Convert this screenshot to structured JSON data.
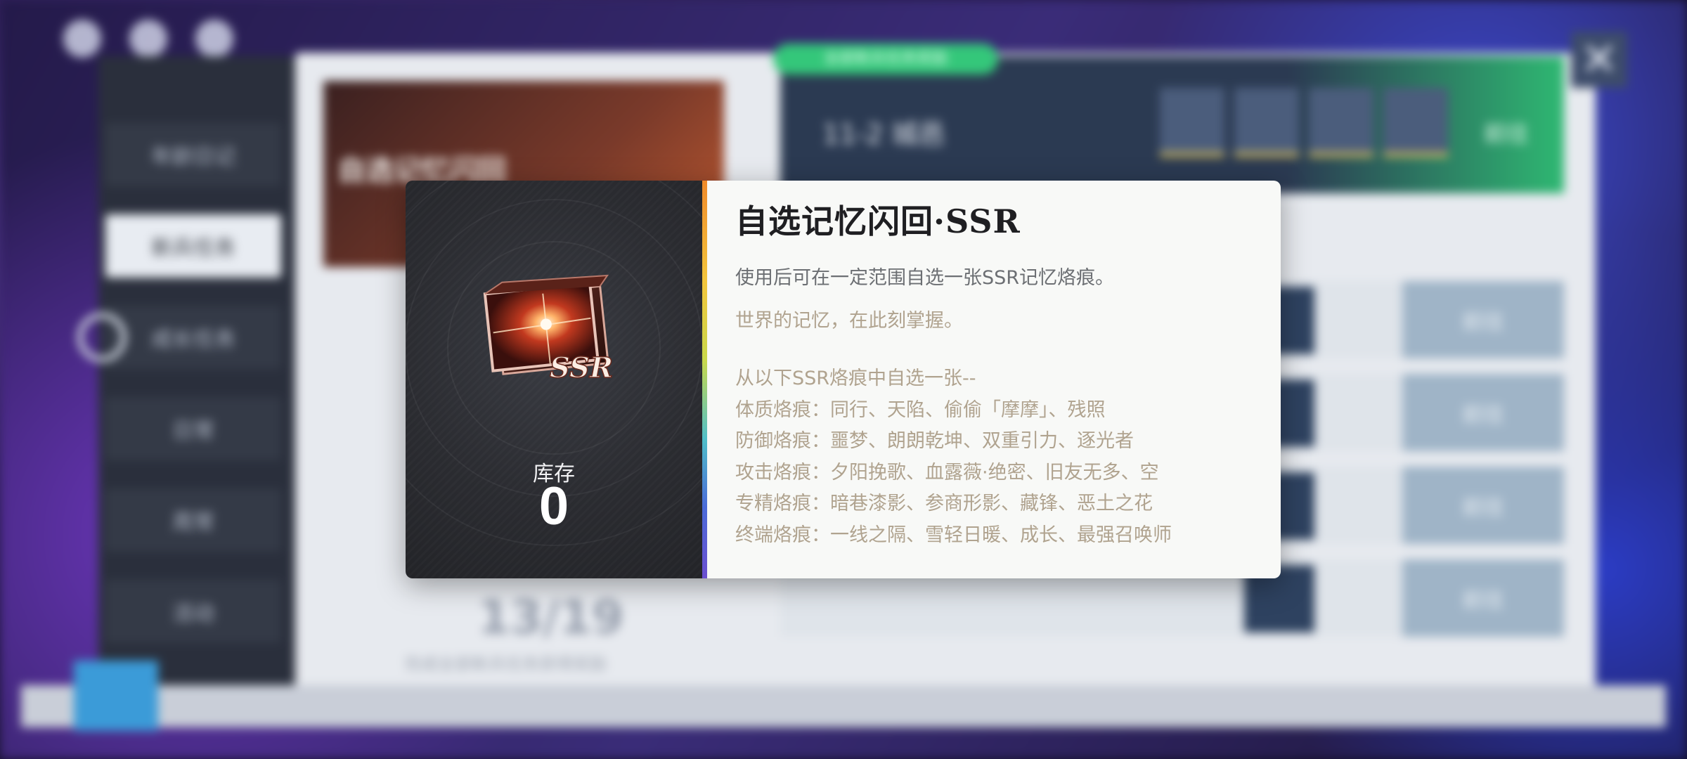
{
  "background": {
    "menu": [
      {
        "label": "年龄日记"
      },
      {
        "label": "新兵任务"
      },
      {
        "label": "成长任务"
      },
      {
        "label": "日常"
      },
      {
        "label": "周常"
      },
      {
        "label": "活动"
      }
    ],
    "promo": {
      "title": "自选记忆闪回"
    },
    "progress": {
      "current": "13",
      "separator": "/",
      "total": "19",
      "caption": "完成全部新兵任务获得奖励"
    },
    "banner": {
      "chip": "全部新兵任务奖励",
      "stage": "11-2 城邑",
      "start": "前往"
    },
    "row_button": "前往",
    "close_glyph": "✕"
  },
  "modal": {
    "stock_label": "库存",
    "stock_value": "0",
    "title": "自选记忆闪回·SSR",
    "description": "使用后可在一定范围自选一张SSR记忆烙痕。",
    "flavor": "世界的记忆，在此刻掌握。",
    "list_header": "从以下SSR烙痕中自选一张--",
    "categories": [
      "体质烙痕：同行、天陷、偷偷「摩摩」、残照",
      "防御烙痕：噩梦、朗朗乾坤、双重引力、逐光者",
      "攻击烙痕：夕阳挽歌、血露薇·绝密、旧友无多、空",
      "专精烙痕：暗巷漆影、参商形影、藏锋、恶土之花",
      "终端烙痕：一线之隔、雪轻日暖、成长、最强召唤师"
    ],
    "icon_badge": "SSR"
  },
  "colors": {
    "accent_orange": "#f08a2a",
    "flavor_text": "#b0a38f",
    "title_text": "#1f1f22"
  }
}
